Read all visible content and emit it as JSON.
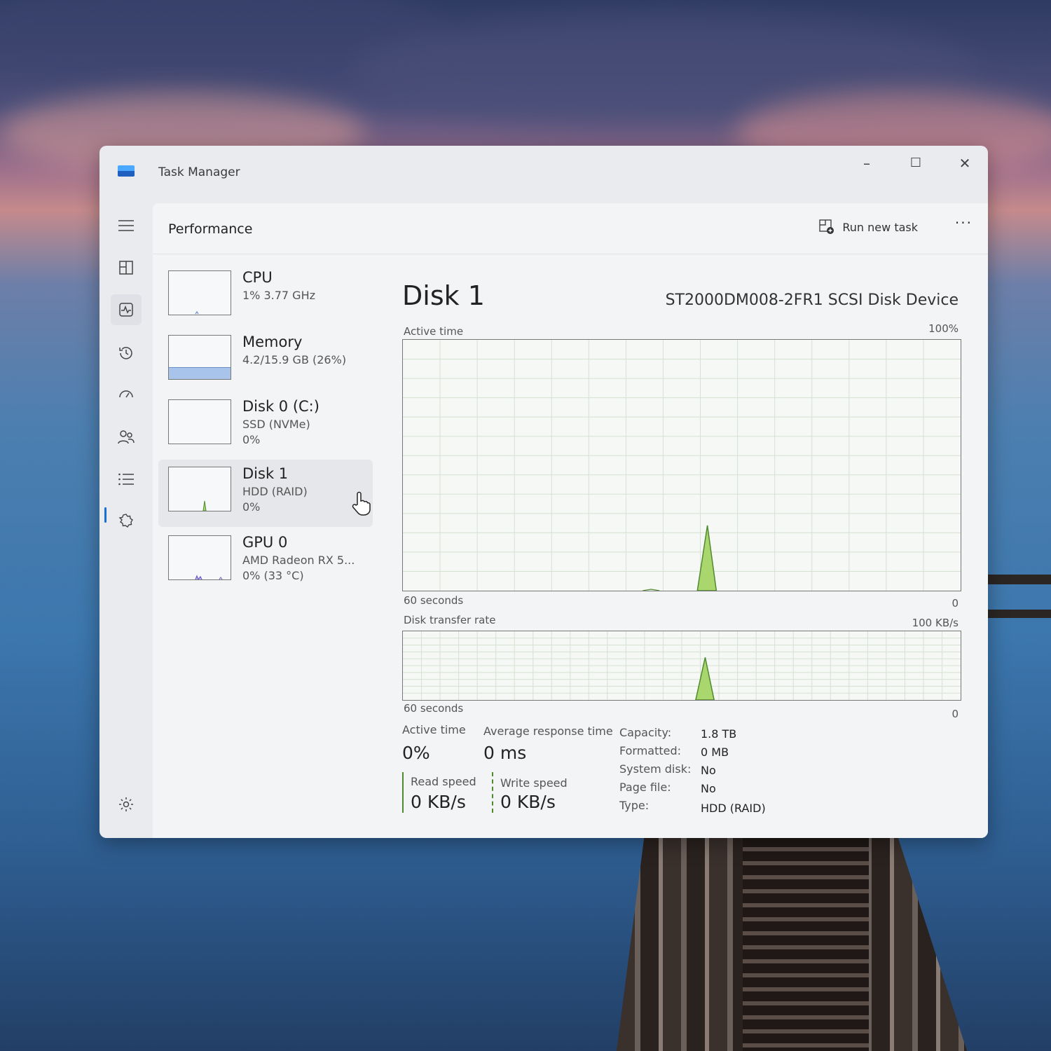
{
  "window": {
    "title": "Task Manager",
    "controls": {
      "minimize": "–",
      "maximize": "☐",
      "close": "✕"
    }
  },
  "header": {
    "page_title": "Performance",
    "run_new_task": "Run new task",
    "more": "···"
  },
  "nav": {
    "items": [
      "menu-icon",
      "processes-icon",
      "performance-icon",
      "app-history-icon",
      "startup-apps-icon",
      "users-icon",
      "details-icon",
      "services-icon",
      "settings-icon"
    ],
    "active": "performance-icon"
  },
  "resources": [
    {
      "name": "CPU",
      "sub": "1% 3.77 GHz",
      "sub2": ""
    },
    {
      "name": "Memory",
      "sub": "4.2/15.9 GB (26%)",
      "sub2": ""
    },
    {
      "name": "Disk 0 (C:)",
      "sub": "SSD (NVMe)",
      "sub2": "0%"
    },
    {
      "name": "Disk 1",
      "sub": "HDD (RAID)",
      "sub2": "0%"
    },
    {
      "name": "GPU 0",
      "sub": "AMD Radeon RX 5...",
      "sub2": "0% (33 °C)"
    }
  ],
  "main": {
    "title": "Disk 1",
    "device": "ST2000DM008-2FR1 SCSI Disk Device",
    "active_time_graph": {
      "label": "Active time",
      "max": "100%",
      "time": "60 seconds",
      "min": "0"
    },
    "transfer_graph": {
      "label": "Disk transfer rate",
      "max": "100 KB/s",
      "time": "60 seconds",
      "min": "0"
    },
    "stats": {
      "active_time_label": "Active time",
      "active_time_value": "0%",
      "avg_response_label": "Average response time",
      "avg_response_value": "0 ms",
      "read_label": "Read speed",
      "read_value": "0 KB/s",
      "write_label": "Write speed",
      "write_value": "0 KB/s"
    },
    "properties": [
      {
        "label": "Capacity:",
        "value": "1.8 TB"
      },
      {
        "label": "Formatted:",
        "value": "0 MB"
      },
      {
        "label": "System disk:",
        "value": "No"
      },
      {
        "label": "Page file:",
        "value": "No"
      },
      {
        "label": "Type:",
        "value": "HDD (RAID)"
      }
    ]
  },
  "colors": {
    "disk_line": "#4f8a2e",
    "disk_fill": "#a9d66d",
    "memory_fill": "#a9c4ea",
    "accent": "#1a6ed8"
  }
}
